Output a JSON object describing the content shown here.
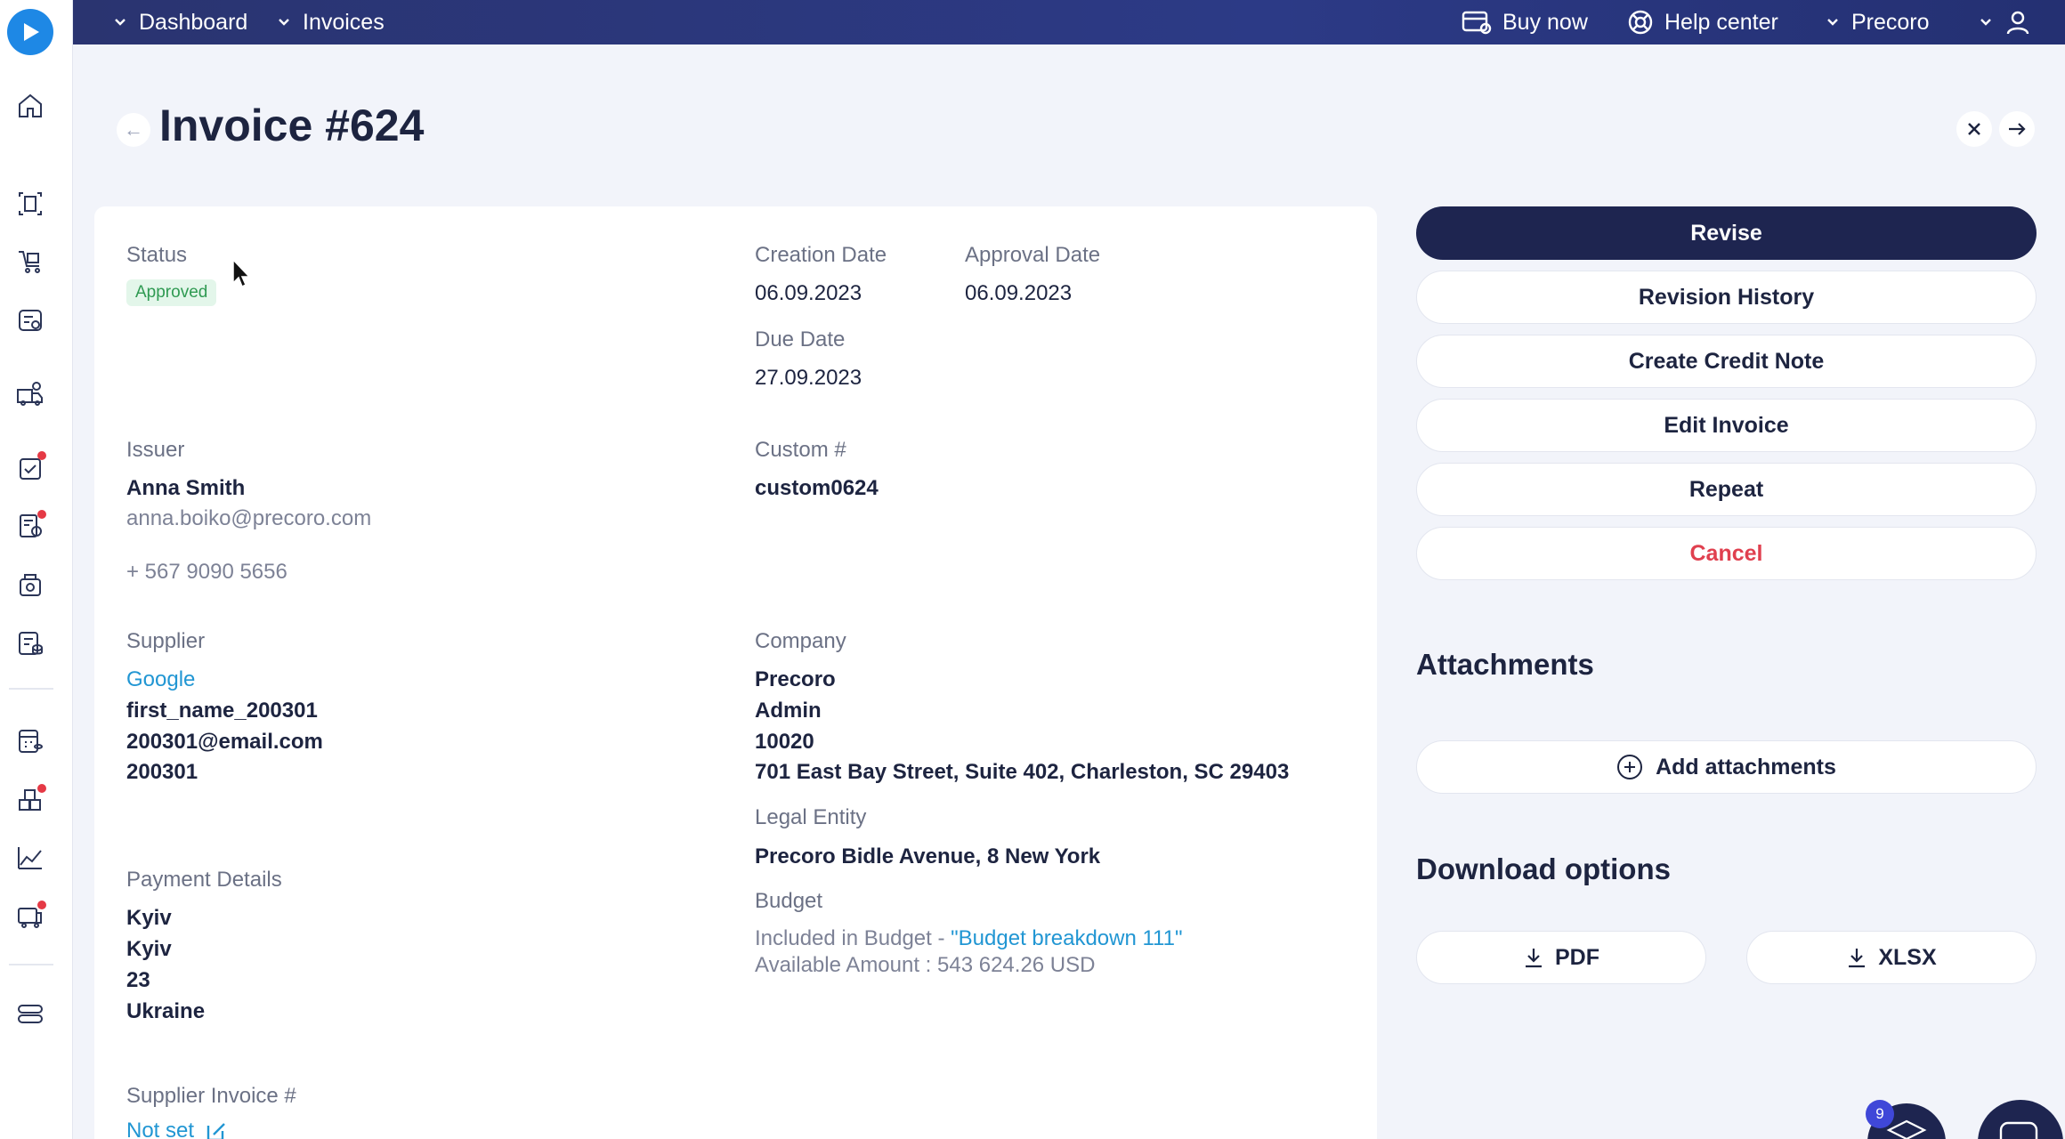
{
  "topbar": {
    "nav": [
      {
        "label": "Dashboard"
      },
      {
        "label": "Invoices"
      }
    ],
    "buy_now": "Buy now",
    "help_center": "Help center",
    "company": "Precoro"
  },
  "page": {
    "title": "Invoice #624"
  },
  "details": {
    "status_label": "Status",
    "status_value": "Approved",
    "creation_date_label": "Creation Date",
    "creation_date": "06.09.2023",
    "approval_date_label": "Approval Date",
    "approval_date": "06.09.2023",
    "due_date_label": "Due Date",
    "due_date": "27.09.2023",
    "issuer_label": "Issuer",
    "issuer_name": "Anna Smith",
    "issuer_email": "anna.boiko@precoro.com",
    "issuer_phone": "+ 567 9090 5656",
    "custom_label": "Custom #",
    "custom_value": "custom0624",
    "supplier_label": "Supplier",
    "supplier_name": "Google",
    "supplier_lines": [
      "first_name_200301",
      "200301@email.com",
      "200301"
    ],
    "company_label": "Company",
    "company_lines": [
      "Precoro",
      "Admin",
      "10020",
      "701 East Bay Street, Suite 402, Charleston, SC 29403"
    ],
    "legal_entity_label": "Legal Entity",
    "legal_entity": "Precoro Bidle Avenue, 8 New York",
    "budget_label": "Budget",
    "budget_included_prefix": "Included in Budget - ",
    "budget_name": "\"Budget breakdown 111\"",
    "budget_available": "Available Amount : 543 624.26 USD",
    "payment_label": "Payment Details",
    "payment_lines": [
      "Kyiv",
      "Kyiv",
      "23",
      "Ukraine"
    ],
    "supplier_invoice_label": "Supplier Invoice #",
    "supplier_invoice_value": "Not set"
  },
  "actions": {
    "revise": "Revise",
    "revision_history": "Revision History",
    "create_credit_note": "Create Credit Note",
    "edit_invoice": "Edit Invoice",
    "repeat": "Repeat",
    "cancel": "Cancel"
  },
  "attachments": {
    "title": "Attachments",
    "add": "Add attachments"
  },
  "downloads": {
    "title": "Download options",
    "pdf": "PDF",
    "xlsx": "XLSX"
  },
  "notifications": {
    "count": "9"
  },
  "colors": {
    "primary": "#1e2550",
    "link": "#2196d3",
    "danger": "#e0404f",
    "approved_bg": "#e3f6ea",
    "approved_text": "#2f9a52"
  }
}
